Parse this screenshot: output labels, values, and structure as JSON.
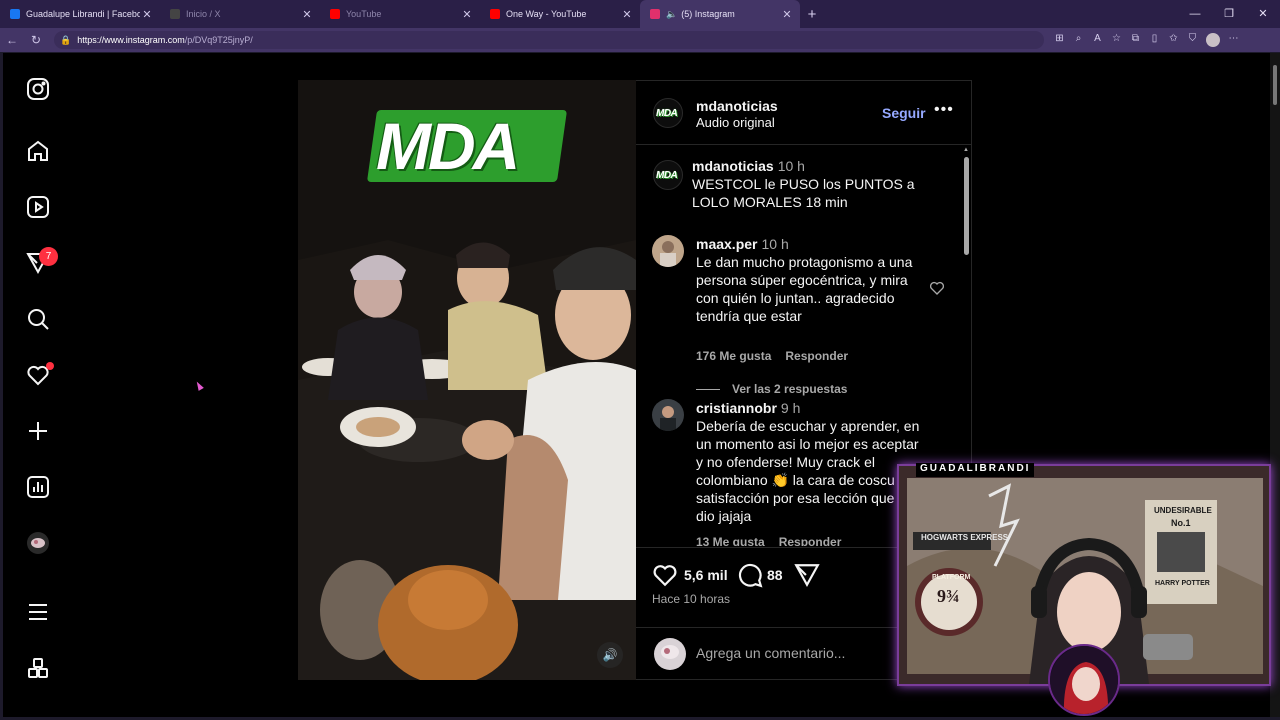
{
  "browser": {
    "tabs": [
      {
        "title": "Guadalupe Librandi | Facebook",
        "icon": "facebook-icon",
        "color": "#1877f2",
        "active": false,
        "dim": false
      },
      {
        "title": "Inicio / X",
        "icon": "x-icon",
        "color": "#444444",
        "active": false,
        "dim": true
      },
      {
        "title": "YouTube",
        "icon": "youtube-icon",
        "color": "#ff0000",
        "active": false,
        "dim": true
      },
      {
        "title": "One Way - YouTube",
        "icon": "youtube-icon",
        "color": "#ff0000",
        "active": false,
        "dim": false
      },
      {
        "title": "(5) Instagram",
        "icon": "instagram-icon",
        "color": "#e1306c",
        "active": true,
        "dim": false
      }
    ],
    "url_host": "https://www.instagram.com",
    "url_path": "/p/DVq9T25jnyP/"
  },
  "sidebar": {
    "notification_count": "7"
  },
  "post": {
    "media_overlay_text": "MDA",
    "author": "mdanoticias",
    "audio": "Audio original",
    "follow_label": "Seguir",
    "avatar_text": "MDA",
    "caption": {
      "user": "mdanoticias",
      "time": "10 h",
      "text": "WESTCOL le PUSO los PUNTOS a LOLO MORALES 18 min"
    },
    "comments": [
      {
        "user": "maax.per",
        "time": "10 h",
        "text": "Le dan mucho protagonismo a una persona súper egocéntrica, y mira con quién lo juntan.. agradecido tendría que estar",
        "likes": "176 Me gusta",
        "reply": "Responder",
        "replies": "Ver las 2 respuestas"
      },
      {
        "user": "cristiannobr",
        "time": "9 h",
        "text": "Debería de escuchar y aprender, en un momento asi lo mejor es aceptar y no ofenderse! Muy crack el colombiano 👏 la cara de coscu de satisfacción por esa lección que le dio jajaja",
        "likes": "13 Me gusta",
        "reply": "Responder"
      }
    ],
    "likes_count": "5,6 mil",
    "comments_count": "88",
    "posted": "Hace 10 horas",
    "add_comment_placeholder": "Agrega un comentario..."
  },
  "stream_overlay": {
    "name": "GUADALIBRANDI",
    "sign_express": "HOGWARTS EXPRESS",
    "sign_platform": "PLATFORM",
    "sign_number": "9¾",
    "poster_title": "UNDESIRABLE",
    "poster_number": "No.1",
    "poster_name": "HARRY POTTER"
  }
}
